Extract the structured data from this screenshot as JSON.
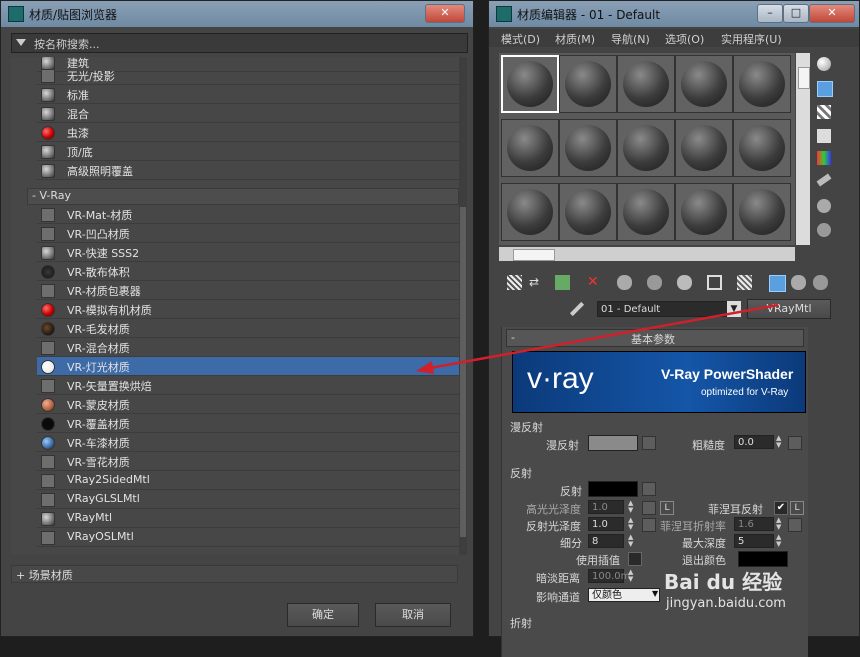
{
  "left_window": {
    "title": "材质/贴图浏览器",
    "search_placeholder": "按名称搜索...",
    "items_top": [
      "建筑",
      "无光/投影",
      "标准",
      "混合",
      "虫漆",
      "顶/底",
      "高级照明覆盖"
    ],
    "vray_group": "- V-Ray",
    "vray_items": [
      "VR-Mat-材质",
      "VR-凹凸材质",
      "VR-快速 SSS2",
      "VR-散布体积",
      "VR-材质包裹器",
      "VR-模拟有机材质",
      "VR-毛发材质",
      "VR-混合材质",
      "VR-灯光材质",
      "VR-矢量置换烘焙",
      "VR-蒙皮材质",
      "VR-覆盖材质",
      "VR-车漆材质",
      "VR-雪花材质",
      "VRay2SidedMtl",
      "VRayGLSLMtl",
      "VRayMtl",
      "VRayOSLMtl"
    ],
    "scene_group": "+ 场景材质",
    "ok_label": "确定",
    "cancel_label": "取消"
  },
  "right_window": {
    "title": "材质编辑器 - 01 - Default",
    "menu": [
      "模式(D)",
      "材质(M)",
      "导航(N)",
      "选项(O)",
      "实用程序(U)"
    ],
    "material_name": "01 - Default",
    "material_type": "VRayMtl",
    "rollout_title": "基本参数",
    "banner_logo": "v·ray",
    "banner_title": "V-Ray PowerShader",
    "banner_sub": "optimized for V-Ray",
    "diffuse_group": "漫反射",
    "diffuse_label": "漫反射",
    "roughness_label": "粗糙度",
    "roughness_value": "0.0",
    "reflect_group": "反射",
    "reflect_label": "反射",
    "hilight_gloss_label": "高光光泽度",
    "hilight_gloss_value": "1.0",
    "lock_letter": "L",
    "fresnel_label": "菲涅耳反射",
    "refl_gloss_label": "反射光泽度",
    "refl_gloss_value": "1.0",
    "fresnel_ior_label": "菲涅耳折射率",
    "fresnel_ior_value": "1.6",
    "subdivs_label": "细分",
    "subdivs_value": "8",
    "max_depth_label": "最大深度",
    "max_depth_value": "5",
    "use_interp_label": "使用插值",
    "exit_color_label": "退出颜色",
    "dim_dist_label": "暗淡距离",
    "dim_dist_value": "100.0m",
    "affect_channels_label": "影响通道",
    "affect_channels_value": "仅颜色",
    "refract_group": "折射"
  },
  "watermark": {
    "brand": "Bai du 经验",
    "url": "jingyan.baidu.com"
  },
  "colors": {
    "accent": "#3d6ba8",
    "arrow": "#d0202a",
    "banner_bg": "#0b3a7a"
  }
}
